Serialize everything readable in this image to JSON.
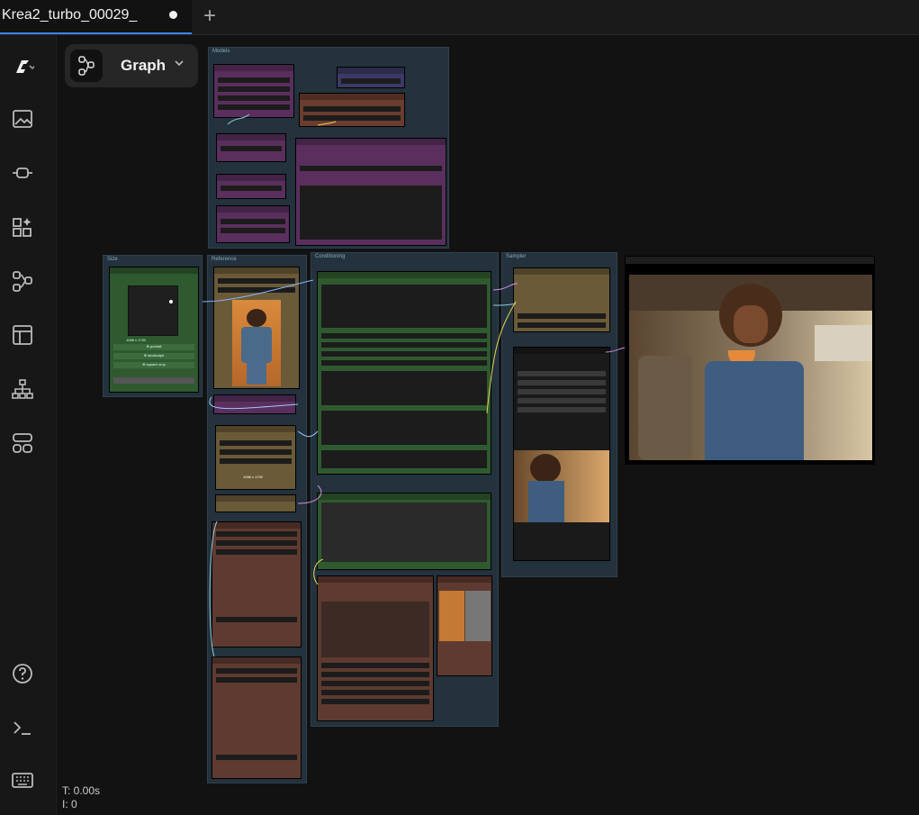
{
  "tab": {
    "title": "Krea2_turbo_00029_",
    "new_tab_symbol": "+"
  },
  "graph_menu": {
    "label": "Graph",
    "chevron": "⌄"
  },
  "sidebar": {
    "items": [
      {
        "name": "logo-icon"
      },
      {
        "name": "images-icon"
      },
      {
        "name": "nodes-library-icon"
      },
      {
        "name": "models-icon"
      },
      {
        "name": "workflows-icon"
      },
      {
        "name": "templates-icon"
      },
      {
        "name": "node-map-icon"
      },
      {
        "name": "queue-icon"
      },
      {
        "name": "help-icon"
      },
      {
        "name": "console-icon"
      },
      {
        "name": "keyboard-icon"
      }
    ]
  },
  "canvas": {
    "groups": {
      "models": "Models",
      "size": "Size",
      "reference": "Reference",
      "conditioning": "Conditioning",
      "sampler": "Sampler"
    },
    "size_node": {
      "resolution": "1088 x 1792",
      "buttons": [
        "⊕ portrait",
        "⊕ landscape",
        "⊕ square crop"
      ]
    },
    "reference_resolution": "1088 x 1792"
  },
  "status": {
    "time": "T: 0.00s",
    "iterations": "I: 0"
  }
}
